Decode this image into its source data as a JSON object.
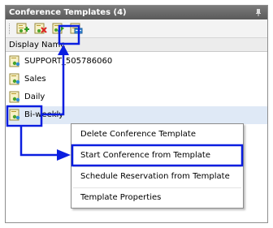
{
  "panel": {
    "title": "Conference Templates (4)",
    "column_header": "Display Name"
  },
  "toolbar": {
    "buttons": [
      {
        "name": "add-template-button",
        "icon": "add-template-icon"
      },
      {
        "name": "delete-template-button",
        "icon": "delete-template-icon"
      },
      {
        "name": "start-conference-button",
        "icon": "start-conference-icon"
      },
      {
        "name": "edit-template-button",
        "icon": "edit-template-icon"
      }
    ]
  },
  "templates": [
    {
      "label": "SUPPORT_505786060",
      "icon": "conference-template-icon"
    },
    {
      "label": "Sales",
      "icon": "conference-template-icon"
    },
    {
      "label": "Daily",
      "icon": "conference-template-icon"
    },
    {
      "label": "Bi-weekly",
      "icon": "conference-template-icon",
      "selected": true
    }
  ],
  "context_menu": {
    "items": [
      {
        "label": "Delete Conference Template"
      },
      {
        "label": "Start Conference from Template",
        "highlighted": true
      },
      {
        "label": "Schedule Reservation from Template"
      },
      {
        "label": "Template Properties"
      }
    ]
  },
  "colors": {
    "annotation_blue": "#0a1ee0",
    "titlebar_gray": "#676767",
    "selection_blue": "#dfe9f6"
  }
}
